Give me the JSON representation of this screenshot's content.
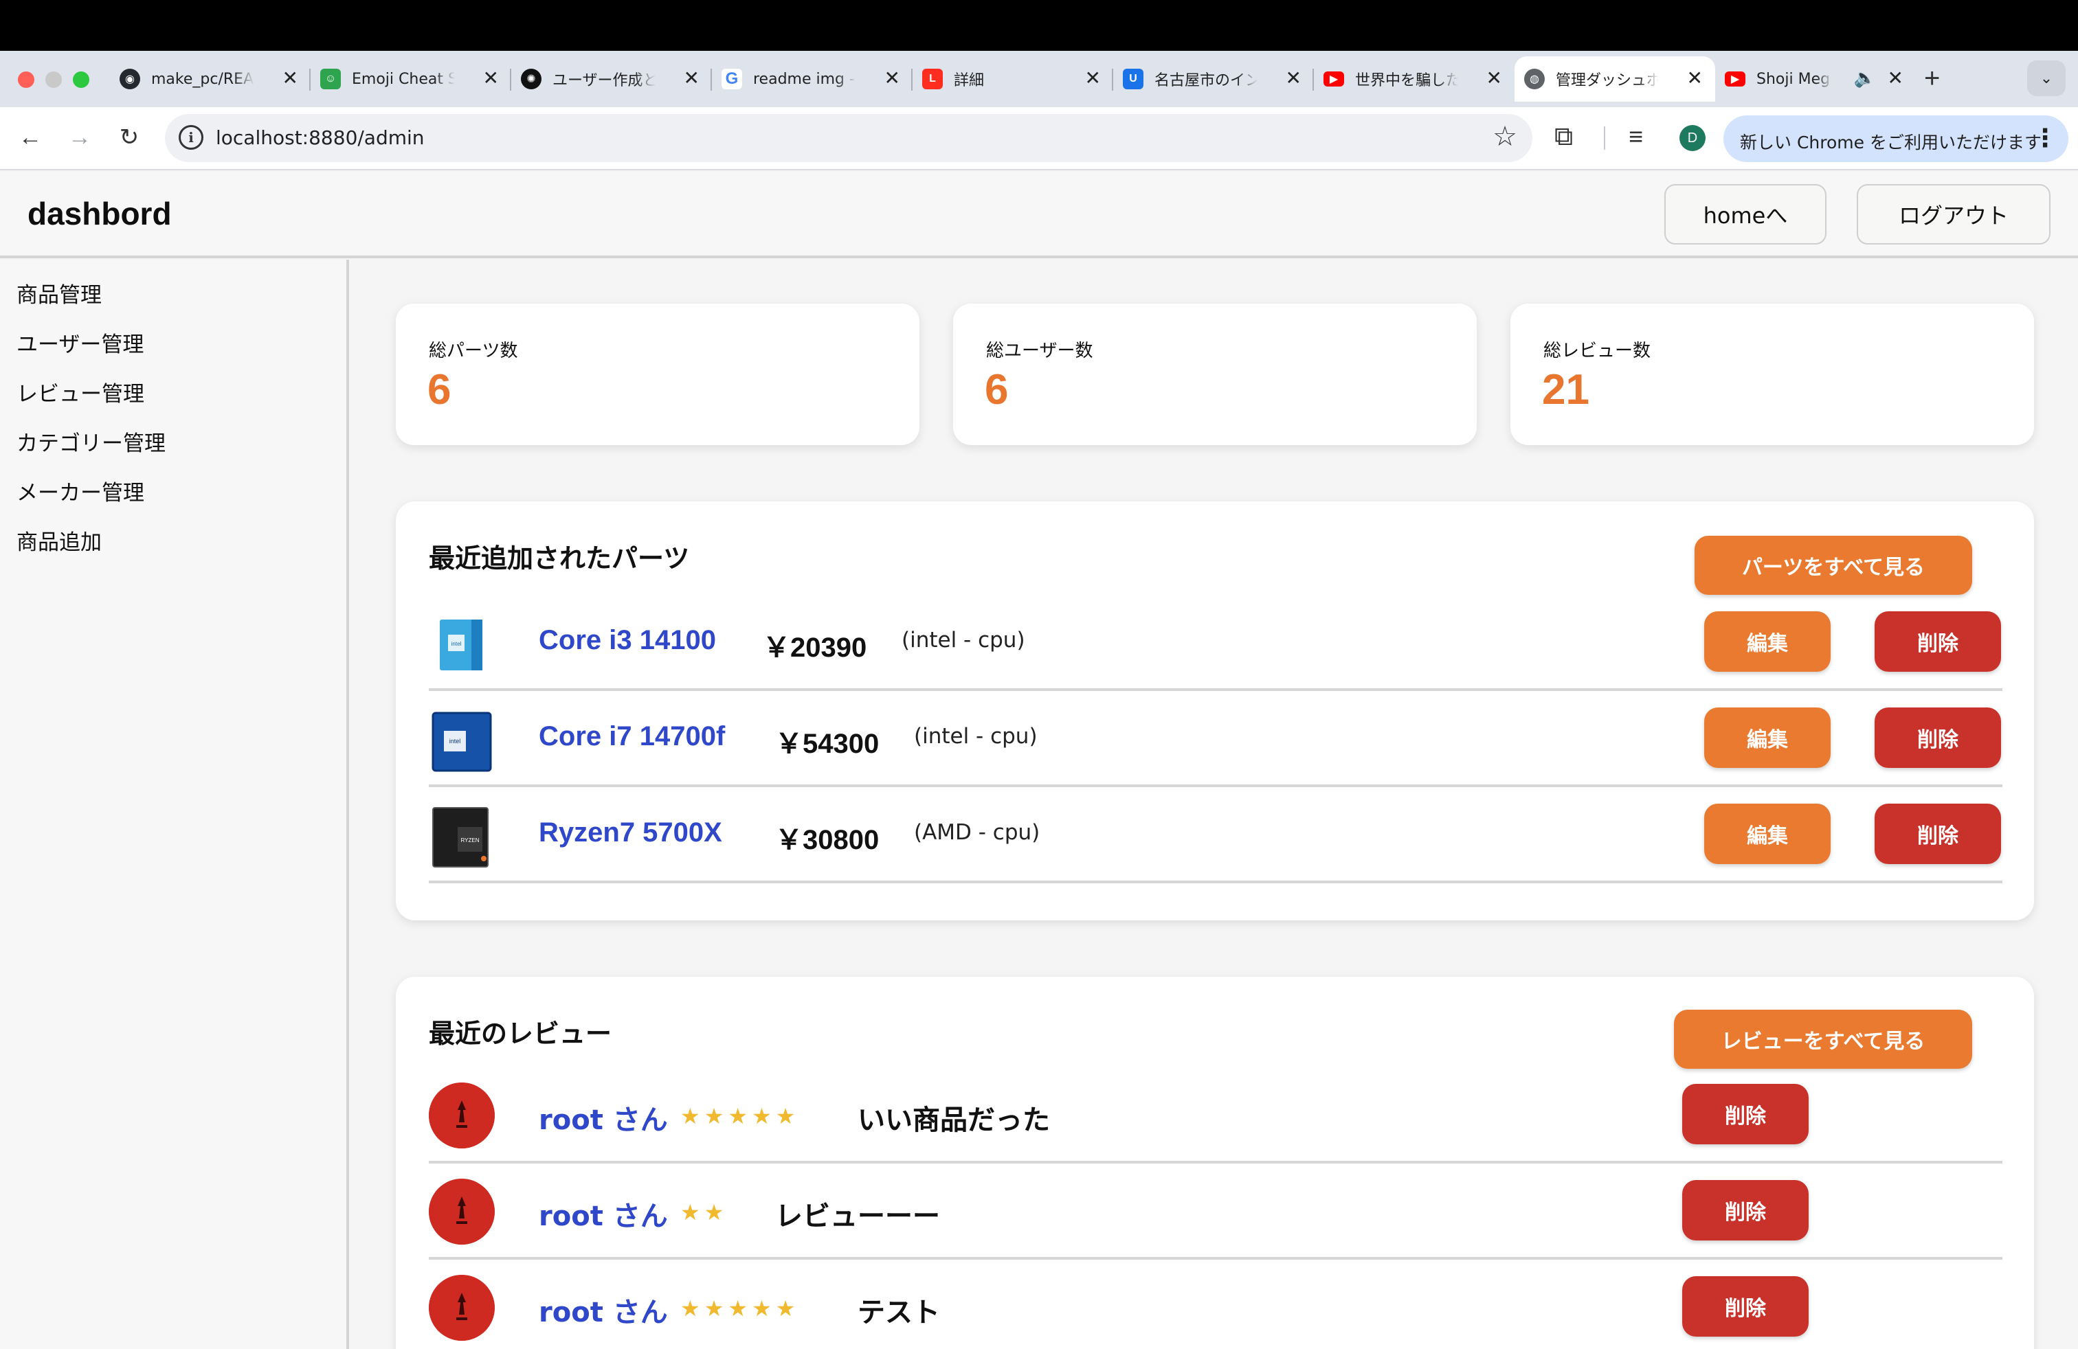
{
  "browser": {
    "tabs": [
      {
        "title": "make_pc/REA",
        "icon": "github-icon",
        "color": "#24292f"
      },
      {
        "title": "Emoji Cheat S",
        "icon": "emoji-cheat-icon",
        "color": "#2ea44f"
      },
      {
        "title": "ユーザー作成と",
        "icon": "openai-icon",
        "color": "#111111"
      },
      {
        "title": "readme img -",
        "icon": "google-icon",
        "color": "#4285f4"
      },
      {
        "title": "詳細",
        "icon": "laravel-icon",
        "color": "#ff2d20"
      },
      {
        "title": "名古屋市のイン",
        "icon": "site-icon",
        "color": "#1a73e8"
      },
      {
        "title": "世界中を騙した",
        "icon": "youtube-icon",
        "color": "#ff0000"
      },
      {
        "title": "管理ダッシュボ",
        "icon": "globe-icon",
        "color": "#5f6368",
        "active": true
      },
      {
        "title": "Shoji Meg",
        "icon": "youtube-icon",
        "color": "#ff0000",
        "audio": true
      }
    ],
    "url": "localhost:8880/admin",
    "profile_initial": "D",
    "update_label": "新しい Chrome をご利用いただけます"
  },
  "header": {
    "brand": "dashbord",
    "home_label": "homeへ",
    "logout_label": "ログアウト"
  },
  "sidebar": {
    "items": [
      "商品管理",
      "ユーザー管理",
      "レビュー管理",
      "カテゴリー管理",
      "メーカー管理",
      "商品追加"
    ]
  },
  "stats": [
    {
      "label": "総パーツ数",
      "value": "6"
    },
    {
      "label": "総ユーザー数",
      "value": "6"
    },
    {
      "label": "総レビュー数",
      "value": "21"
    }
  ],
  "recent_parts": {
    "title": "最近追加されたパーツ",
    "view_all_label": "パーツをすべて見る",
    "edit_label": "編集",
    "delete_label": "削除",
    "items": [
      {
        "name": "Core i3 14100",
        "price": "￥20390",
        "meta": "(intel - cpu)",
        "thumb": "intel-core-i3-box"
      },
      {
        "name": "Core i7 14700f",
        "price": "￥54300",
        "meta": "(intel - cpu)",
        "thumb": "intel-core-i7-box"
      },
      {
        "name": "Ryzen7 5700X",
        "price": "￥30800",
        "meta": "(AMD - cpu)",
        "thumb": "amd-ryzen-box"
      }
    ]
  },
  "recent_reviews": {
    "title": "最近のレビュー",
    "view_all_label": "レビューをすべて見る",
    "delete_label": "削除",
    "items": [
      {
        "user": "root さん",
        "stars": "★★★★★",
        "rating": 5,
        "comment": "いい商品だった"
      },
      {
        "user": "root さん",
        "stars": "★★",
        "rating": 2,
        "comment": "レビューーー"
      },
      {
        "user": "root さん",
        "stars": "★★★★★",
        "rating": 5,
        "comment": "テスト"
      }
    ]
  },
  "colors": {
    "accent_orange": "#ea7a2f",
    "danger_red": "#c9322b",
    "link_blue": "#2f48c9",
    "star_yellow": "#f0b92e"
  }
}
